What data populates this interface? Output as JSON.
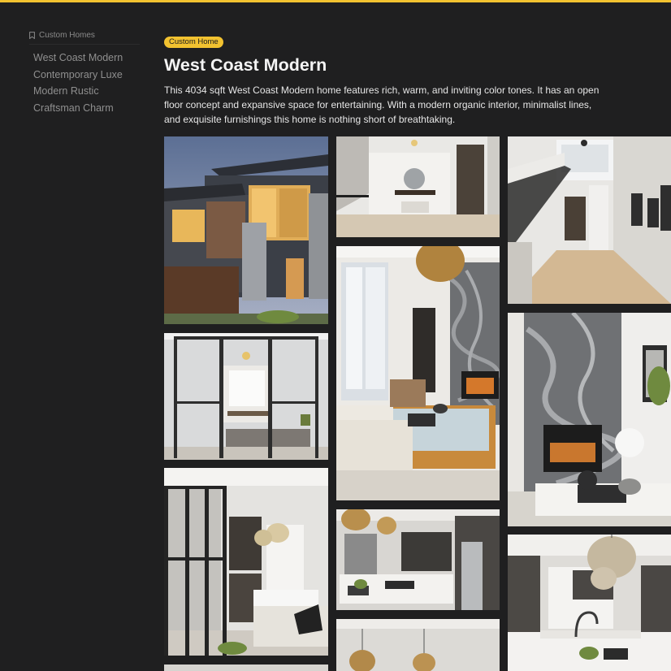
{
  "sidebar": {
    "heading": "Custom Homes",
    "items": [
      {
        "label": "West Coast Modern"
      },
      {
        "label": "Contemporary Luxe"
      },
      {
        "label": "Modern Rustic"
      },
      {
        "label": "Craftsman Charm"
      }
    ]
  },
  "main": {
    "badge": "Custom Home",
    "title": "West Coast Modern",
    "description": "This 4034 sqft West Coast Modern home features rich, warm, and inviting color tones. It has an open floor concept and expansive space for entertaining. With a modern organic interior, minimalist lines, and exquisite furnishings this home is nothing short of breathtaking."
  },
  "colors": {
    "background": "#1f1f20",
    "accent": "#f2c230",
    "sidebar_text": "#8f8f8f"
  },
  "icons": {
    "sidebar_heading": "bookmark-icon"
  }
}
